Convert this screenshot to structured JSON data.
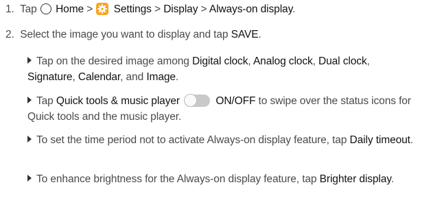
{
  "steps": [
    {
      "num": "1.",
      "tap": "Tap",
      "home": "Home",
      "sep1": " > ",
      "settings": "Settings",
      "sep2": " > ",
      "display": "Display",
      "sep3": " > ",
      "aod": "Always-on display",
      "end": "."
    },
    {
      "num": "2.",
      "text_a": "Select the image you want to display and tap ",
      "save": "SAVE",
      "end": "."
    }
  ],
  "bullets": [
    {
      "a": "Tap on the desired image among ",
      "digital": "Digital clock",
      "c1": ", ",
      "analog": "Analog clock",
      "c2": ", ",
      "dual": "Dual clock",
      "c3": ", ",
      "signature": "Signature",
      "c4": ", ",
      "calendar": "Calendar",
      "c5": ", and ",
      "image": "Image",
      "end": "."
    },
    {
      "a": "Tap ",
      "quick": "Quick tools & music player",
      "onoff": "ON/OFF",
      "b": " to swipe over the status icons for Quick tools and the music player."
    },
    {
      "a": "To set the time period not to activate Always-on display feature, tap ",
      "daily": "Daily timeout",
      "end": "."
    },
    {
      "a": "To enhance brightness for the Always-on display feature, tap ",
      "brighter": "Brighter display",
      "end": "."
    }
  ],
  "colors": {
    "settings_icon": "#f5a623",
    "text": "#4a4a4a",
    "emphasis": "#111111"
  }
}
